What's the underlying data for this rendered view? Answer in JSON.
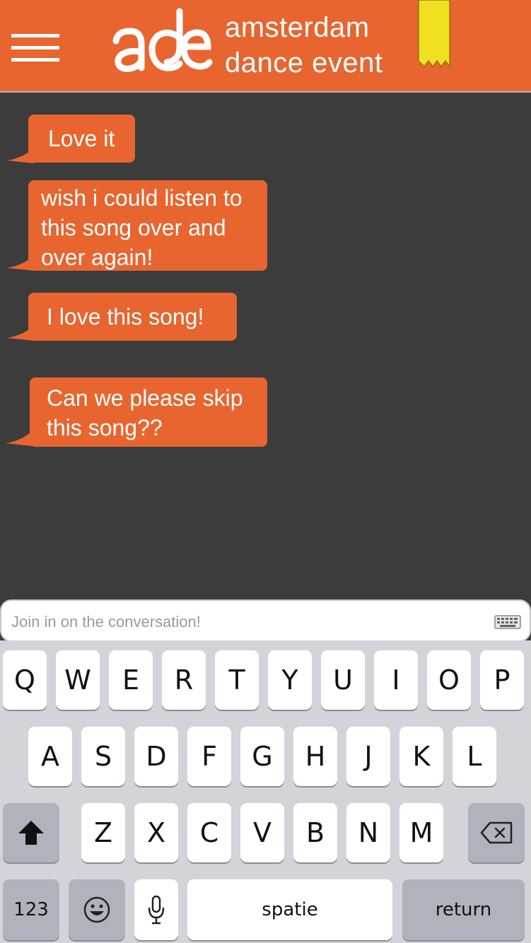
{
  "header": {
    "brand_line1": "amsterdam",
    "brand_line2": "dance event",
    "logo_text": "ade",
    "accent_color": "#e8652f",
    "bookmark_color": "#f0e020"
  },
  "messages": [
    {
      "text": "Love it"
    },
    {
      "text": "wish i could listen to this song over and over again!"
    },
    {
      "text": "I love this song!"
    },
    {
      "text": "Can we please skip this song??"
    }
  ],
  "compose": {
    "placeholder": "Join in on the conversation!",
    "value": ""
  },
  "keyboard": {
    "row1": [
      "Q",
      "W",
      "E",
      "R",
      "T",
      "Y",
      "U",
      "I",
      "O",
      "P"
    ],
    "row2": [
      "A",
      "S",
      "D",
      "F",
      "G",
      "H",
      "J",
      "K",
      "L"
    ],
    "row3": [
      "Z",
      "X",
      "C",
      "V",
      "B",
      "N",
      "M"
    ],
    "numbers_label": "123",
    "space_label": "spatie",
    "return_label": "return",
    "shift_icon": "shift-arrow-icon",
    "delete_icon": "backspace-icon",
    "emoji_icon": "smiley-icon",
    "mic_icon": "microphone-icon"
  }
}
